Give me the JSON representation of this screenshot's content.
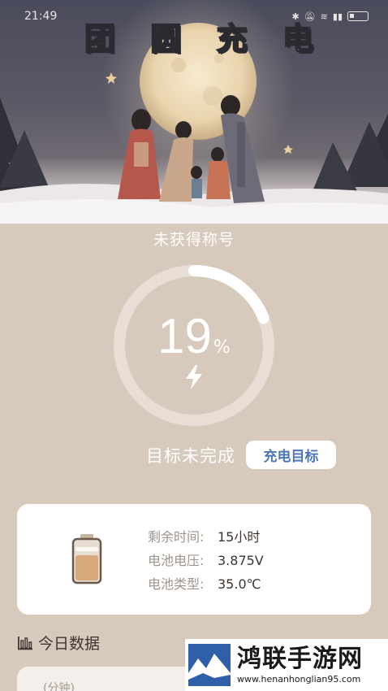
{
  "status_bar": {
    "time": "21:49",
    "icons": [
      "bluetooth-icon",
      "mute-icon",
      "wifi-icon",
      "signal-icon",
      "battery-icon"
    ]
  },
  "banner": {
    "title_chars": [
      "团",
      "圆",
      "充",
      "电"
    ]
  },
  "charging": {
    "honor_title": "未获得称号",
    "percent_value": "19",
    "percent_unit": "%",
    "level_fraction": 0.19,
    "goal_status": "目标未完成",
    "goal_button": "充电目标"
  },
  "info_card": {
    "rows": [
      {
        "label": "剩余时间:",
        "value": "15小时"
      },
      {
        "label": "电池电压:",
        "value": "3.875V"
      },
      {
        "label": "电池类型:",
        "value": "35.0℃"
      }
    ]
  },
  "today": {
    "title": "今日数据",
    "unit_label": "(分钟)"
  },
  "watermark": {
    "name": "鸿联手游网",
    "url": "www.henanhonglian95.com"
  },
  "colors": {
    "background": "#d8c9bd",
    "ring_track": "#e8ded6",
    "ring_progress": "#ffffff",
    "button_text": "#4e77b8"
  }
}
